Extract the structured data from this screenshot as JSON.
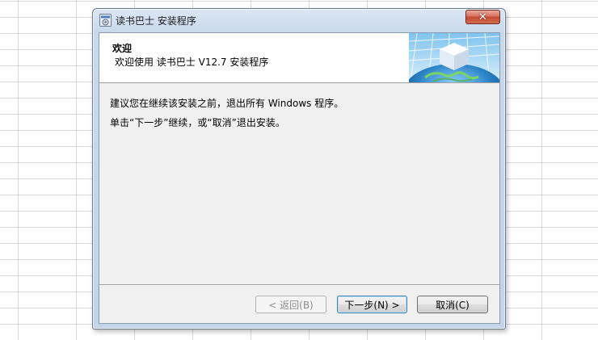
{
  "window": {
    "title": "读书巴士 安装程序",
    "close_glyph": "✕",
    "icon": "installer-icon"
  },
  "header": {
    "title": "欢迎",
    "subtitle": "欢迎使用 读书巴士 V12.7 安装程序",
    "image": "globe-cube-graphic"
  },
  "body": {
    "line1": "建议您在继续该安装之前，退出所有 Windows 程序。",
    "line2": "单击“下一步”继续，或“取消”退出安装。"
  },
  "buttons": {
    "back": "< 返回(B)",
    "next": "下一步(N) >",
    "cancel": "取消(C)"
  },
  "colors": {
    "accent": "#3c7fb1",
    "close": "#c8462d",
    "globe": "#2a82c6",
    "grid": "#d8d8d8"
  }
}
